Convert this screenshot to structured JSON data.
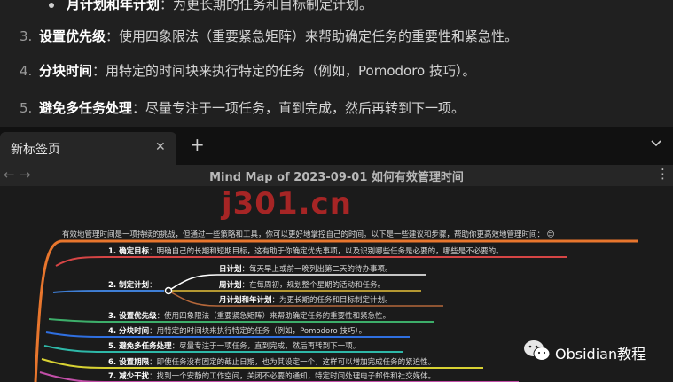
{
  "note": {
    "sub_bullet": {
      "title": "月计划和年计划",
      "text": "：为更长期的任务和目标制定计划。"
    },
    "items": [
      {
        "num": "3.",
        "title": "设置优先级",
        "text": "：使用四象限法（重要紧急矩阵）来帮助确定任务的重要性和紧急性。"
      },
      {
        "num": "4.",
        "title": "分块时间",
        "text": "：用特定的时间块来执行特定的任务（例如，Pomodoro 技巧）。"
      },
      {
        "num": "5.",
        "title": "避免多任务处理",
        "text": "：尽量专注于一项任务，直到完成，然后再转到下一项。"
      }
    ]
  },
  "browser": {
    "tab_label": "新标签页",
    "tab_close": "✕",
    "new_tab": "+",
    "back": "←",
    "forward": "→",
    "page_title": "Mind Map of 2023-09-01  如何有效管理时间",
    "more": "⋮"
  },
  "mindmap": {
    "root": "有效地管理时间是一项持续的挑战，但通过一些策略和工具，你可以更好地掌控自己的时间。以下是一些建议和步骤，帮助你更高效地管理时间：",
    "root_emoji": "😊",
    "branches": [
      {
        "title": "1. 确定目标",
        "text": "：明确自己的长期和短期目标，这有助于你确定优先事项，以及识别哪些任务是必要的，哪些是不必要的。"
      },
      {
        "title": "2. 制定计划",
        "text": "："
      },
      {
        "title": "3. 设置优先级",
        "text": "：使用四象限法（重要紧急矩阵）来帮助确定任务的重要性和紧急性。"
      },
      {
        "title": "4. 分块时间",
        "text": "：用特定的时间块来执行特定的任务（例如，Pomodoro 技巧）。"
      },
      {
        "title": "5. 避免多任务处理",
        "text": "：尽量专注于一项任务，直到完成，然后再转到下一项。"
      },
      {
        "title": "6. 设置期限",
        "text": "：即使任务没有固定的截止日期，也为其设定一个，这样可以增加完成任务的紧迫性。"
      },
      {
        "title": "7. 减少干扰",
        "text": "：找到一个安静的工作空间，关闭不必要的通知，特定时间处理电子邮件和社交媒体。"
      }
    ],
    "sub_branches": [
      {
        "title": "日计划",
        "text": "：每天早上或前一晚列出第二天的待办事项。"
      },
      {
        "title": "周计划",
        "text": "：在每周初，规划整个星期的活动和任务。"
      },
      {
        "title": "月计划和年计划",
        "text": "：为更长期的任务和目标制定计划。"
      }
    ],
    "watermark": "j301.cn",
    "wechat_label": "Obsidian教程",
    "colors": {
      "root_line": "#e8762d",
      "branch_lines": [
        "#d64545",
        "#3f7fd6",
        "#3dae6a",
        "#2f6fe0",
        "#2eb8a8",
        "#d8d233",
        "#c24fa8"
      ],
      "sub_lines": [
        "#ffffff",
        "#e8c23a",
        "#b5673a"
      ]
    }
  }
}
